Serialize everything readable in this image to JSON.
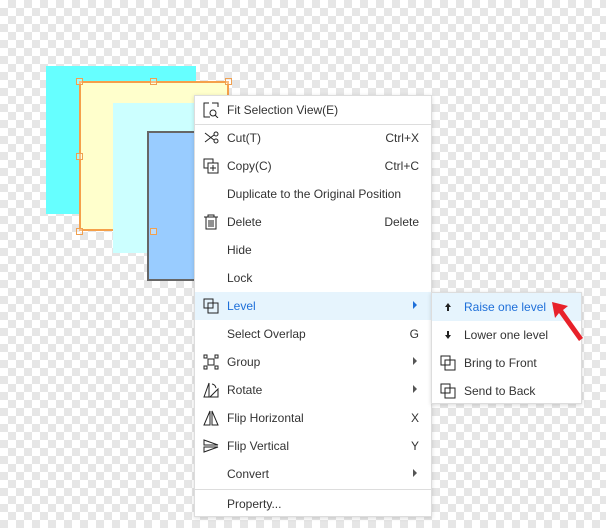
{
  "menu": {
    "items": [
      {
        "label": "Fit Selection View(E)",
        "icon": "fit-view-icon"
      },
      {
        "label": "Cut(T)",
        "shortcut": "Ctrl+X",
        "icon": "scissors-icon"
      },
      {
        "label": "Copy(C)",
        "shortcut": "Ctrl+C",
        "icon": "copy-icon"
      },
      {
        "label": "Duplicate to the Original Position"
      },
      {
        "label": "Delete",
        "shortcut": "Delete",
        "icon": "trash-icon"
      },
      {
        "label": "Hide"
      },
      {
        "label": "Lock"
      },
      {
        "label": "Level",
        "icon": "layers-icon",
        "submenu": true,
        "active": true
      },
      {
        "label": "Select Overlap",
        "shortcut": "G"
      },
      {
        "label": "Group",
        "icon": "group-icon",
        "submenu": true
      },
      {
        "label": "Rotate",
        "icon": "rotate-icon",
        "submenu": true
      },
      {
        "label": "Flip Horizontal",
        "shortcut": "X",
        "icon": "flip-horizontal-icon"
      },
      {
        "label": "Flip Vertical",
        "shortcut": "Y",
        "icon": "flip-vertical-icon"
      },
      {
        "label": "Convert",
        "submenu": true
      },
      {
        "label": "Property..."
      }
    ]
  },
  "submenu": {
    "items": [
      {
        "label": "Raise one level",
        "icon": "arrow-up-icon",
        "active": true
      },
      {
        "label": "Lower one level",
        "icon": "arrow-down-icon"
      },
      {
        "label": "Bring to Front",
        "icon": "bring-front-icon"
      },
      {
        "label": "Send to Back",
        "icon": "send-back-icon"
      }
    ]
  },
  "colors": {
    "accent": "#1e6fd9",
    "highlight": "#e6f4fd",
    "pointer": "#e8212a"
  }
}
